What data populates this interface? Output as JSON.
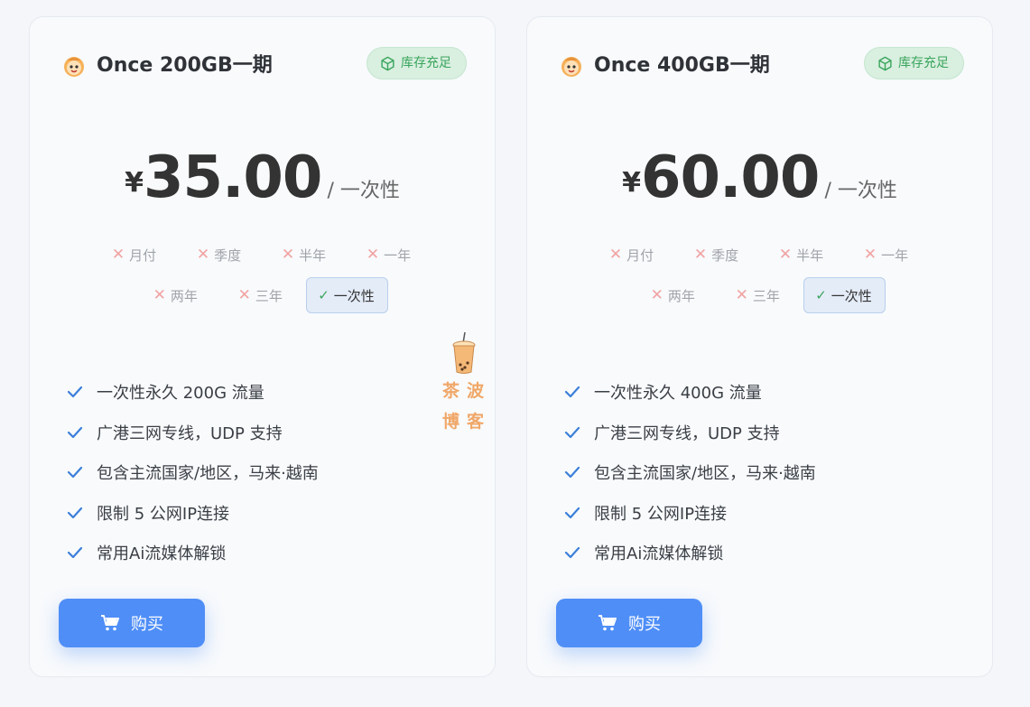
{
  "cards": [
    {
      "title": "Once 200GB一期",
      "stock": "库存充足",
      "currency": "¥",
      "price": "35.00",
      "per": "/ 一次性",
      "periods_row1": [
        "月付",
        "季度",
        "半年",
        "一年"
      ],
      "periods_row2": [
        "两年",
        "三年"
      ],
      "selected_period": "一次性",
      "features": [
        "一次性永久 200G 流量",
        "广港三网专线，UDP 支持",
        "包含主流国家/地区，马来·越南",
        "限制 5 公网IP连接",
        "常用Ai流媒体解锁"
      ],
      "buy_label": "购买"
    },
    {
      "title": "Once 400GB一期",
      "stock": "库存充足",
      "currency": "¥",
      "price": "60.00",
      "per": "/ 一次性",
      "periods_row1": [
        "月付",
        "季度",
        "半年",
        "一年"
      ],
      "periods_row2": [
        "两年",
        "三年"
      ],
      "selected_period": "一次性",
      "features": [
        "一次性永久 400G 流量",
        "广港三网专线，UDP 支持",
        "包含主流国家/地区，马来·越南",
        "限制 5 公网IP连接",
        "常用Ai流媒体解锁"
      ],
      "buy_label": "购买"
    }
  ],
  "watermark": {
    "line1": "茶波",
    "line2": "博客"
  },
  "icons": {
    "logo": "cartoon-face-icon",
    "stock": "cube-icon",
    "unavailable": "x-icon",
    "selected": "check-icon",
    "feature": "check-icon",
    "buy": "cart-icon"
  },
  "colors": {
    "accent": "#4f8ef7",
    "stock_green": "#3aa55c",
    "unavailable_red": "#f1a3a3",
    "watermark_orange": "#f0a768"
  }
}
